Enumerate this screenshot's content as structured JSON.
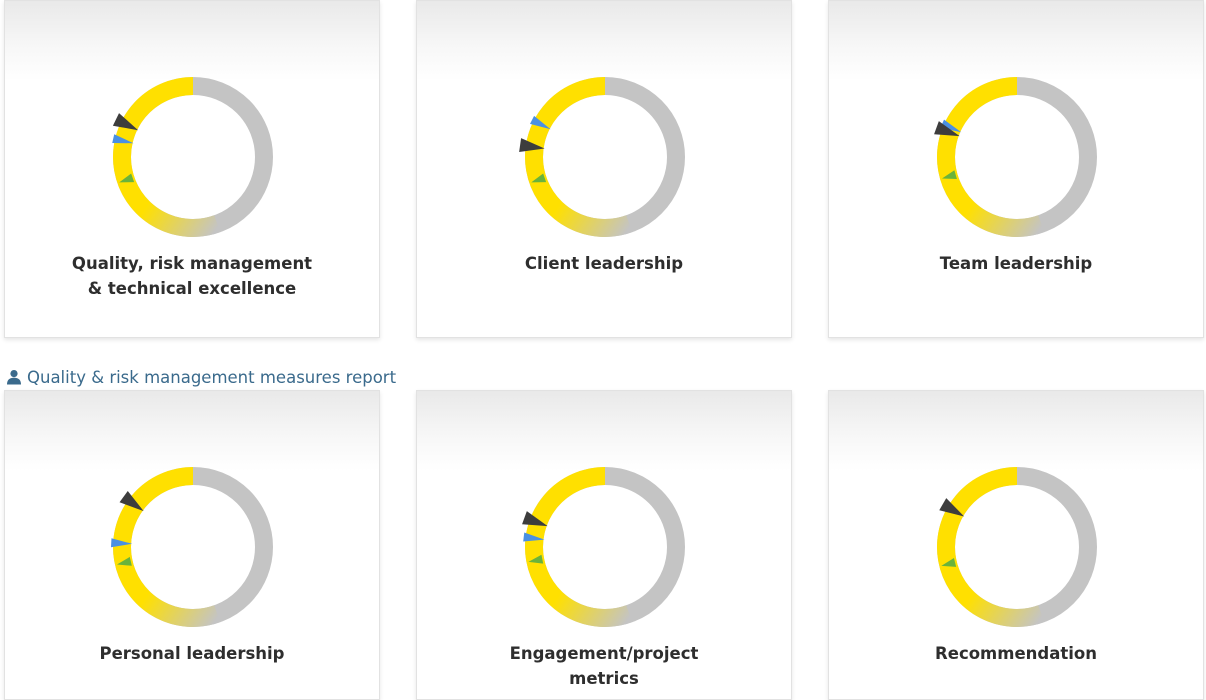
{
  "colors": {
    "ring_track": "#c4c4c4",
    "ring_fill": "#ffe000",
    "marker_dark": "#3d3d3d",
    "marker_blue": "#4a90e2",
    "marker_green": "#69b33c",
    "link": "#3a6a8c"
  },
  "report_link": {
    "icon": "person-icon",
    "label": "Quality & risk management measures report"
  },
  "cards": [
    {
      "title": "Quality, risk management\n& technical excellence",
      "fill_start_deg": 160,
      "markers": [
        {
          "color": "dark",
          "angle_deg": 296
        },
        {
          "color": "blue",
          "angle_deg": 283
        },
        {
          "color": "green",
          "angle_deg": 251
        }
      ]
    },
    {
      "title": "Client leadership",
      "fill_start_deg": 160,
      "markers": [
        {
          "color": "blue",
          "angle_deg": 297
        },
        {
          "color": "dark",
          "angle_deg": 278
        },
        {
          "color": "green",
          "angle_deg": 251
        }
      ]
    },
    {
      "title": "Team leadership",
      "fill_start_deg": 160,
      "markers": [
        {
          "color": "blue",
          "angle_deg": 294
        },
        {
          "color": "dark",
          "angle_deg": 290
        },
        {
          "color": "green",
          "angle_deg": 254
        }
      ]
    },
    {
      "title": "Personal leadership",
      "fill_start_deg": 160,
      "markers": [
        {
          "color": "dark",
          "angle_deg": 306
        },
        {
          "color": "blue",
          "angle_deg": 273
        },
        {
          "color": "green",
          "angle_deg": 257
        }
      ]
    },
    {
      "title": "Engagement/project\nmetrics",
      "fill_start_deg": 160,
      "markers": [
        {
          "color": "dark",
          "angle_deg": 290
        },
        {
          "color": "blue",
          "angle_deg": 277
        },
        {
          "color": "green",
          "angle_deg": 259
        }
      ]
    },
    {
      "title": "Recommendation",
      "fill_start_deg": 160,
      "markers": [
        {
          "color": "dark",
          "angle_deg": 300
        },
        {
          "color": "green",
          "angle_deg": 256
        }
      ]
    }
  ]
}
